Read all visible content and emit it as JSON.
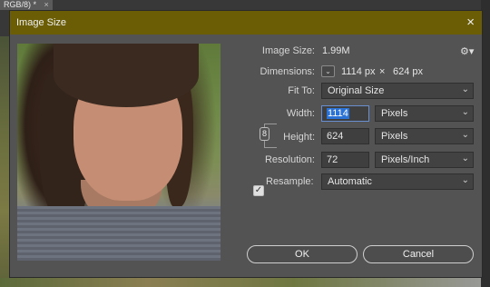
{
  "document_tab": {
    "label": "RGB/8) *",
    "close": "×"
  },
  "dialog": {
    "title": "Image Size",
    "close": "×",
    "image_size": {
      "label": "Image Size:",
      "value": "1.99M"
    },
    "dimensions": {
      "label": "Dimensions:",
      "width": "1114 px",
      "times": "×",
      "height": "624 px"
    },
    "fit_to": {
      "label": "Fit To:",
      "value": "Original Size"
    },
    "width": {
      "label": "Width:",
      "value": "1114",
      "unit": "Pixels"
    },
    "height": {
      "label": "Height:",
      "value": "624",
      "unit": "Pixels"
    },
    "resolution": {
      "label": "Resolution:",
      "value": "72",
      "unit": "Pixels/Inch"
    },
    "resample": {
      "label": "Resample:",
      "checked": true,
      "value": "Automatic"
    },
    "buttons": {
      "ok": "OK",
      "cancel": "Cancel"
    }
  },
  "icons": {
    "gear": "gear-icon",
    "link": "chain-link-icon",
    "dimensions": "dimensions-dropdown-icon",
    "chevron": "chevron-down-icon",
    "check": "checkmark-icon"
  },
  "colors": {
    "titlebar": "#6a5d06",
    "dialog_bg": "#535353",
    "selection": "#2a72d6"
  }
}
